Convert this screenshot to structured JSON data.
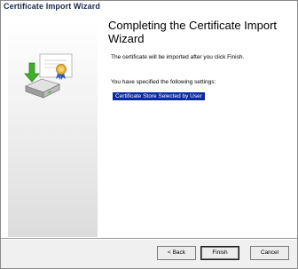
{
  "window": {
    "title": "Certificate Import Wizard"
  },
  "main": {
    "heading": "Completing the Certificate Import Wizard",
    "description": "The certificate will be imported after you click Finish.",
    "settings_label": "You have specified the following settings:",
    "settings": [
      "Certificate Store Selected by User"
    ]
  },
  "buttons": {
    "back": "< Back",
    "finish": "Finish",
    "cancel": "Cancel"
  },
  "icons": {
    "wizard_art": "certificate-import-icon"
  },
  "colors": {
    "selection": "#0a2aa0",
    "title_text": "#1b2a4e"
  }
}
